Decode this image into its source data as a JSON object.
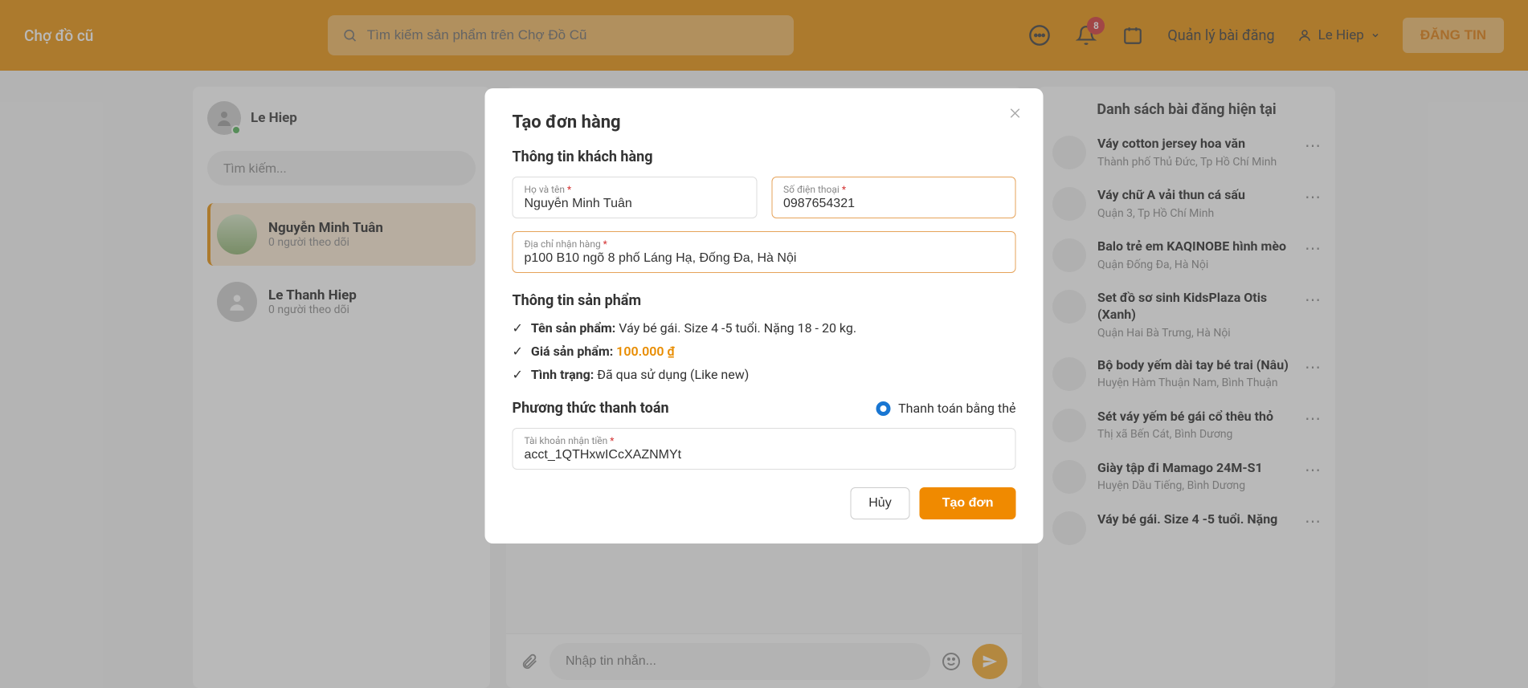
{
  "header": {
    "logo": "Chợ đồ cũ",
    "search_placeholder": "Tìm kiếm sản phẩm trên Chợ Đồ Cũ",
    "notif_badge": "8",
    "manage_label": "Quản lý bài đăng",
    "user_name": "Le Hiep",
    "post_button": "ĐĂNG TIN"
  },
  "left": {
    "me_name": "Le Hiep",
    "search_placeholder": "Tìm kiếm...",
    "conversations": [
      {
        "name": "Nguyễn Minh Tuân",
        "sub": "0 người theo dõi"
      },
      {
        "name": "Le Thanh Hiep",
        "sub": "0 người theo dõi"
      }
    ]
  },
  "chat": {
    "input_placeholder": "Nhập tin nhắn..."
  },
  "right": {
    "title": "Danh sách bài đăng hiện tại",
    "posts": [
      {
        "title": "Váy cotton jersey hoa văn",
        "loc": "Thành phố Thủ Đức, Tp Hồ Chí Minh"
      },
      {
        "title": "Váy chữ A vải thun cá sấu",
        "loc": "Quận 3, Tp Hồ Chí Minh"
      },
      {
        "title": "Balo trẻ em KAQINOBE hình mèo",
        "loc": "Quận Đống Đa, Hà Nội"
      },
      {
        "title": "Set đồ sơ sinh KidsPlaza Otis (Xanh)",
        "loc": "Quận Hai Bà Trưng, Hà Nội"
      },
      {
        "title": "Bộ body yếm dài tay bé trai (Nâu)",
        "loc": "Huyện Hàm Thuận Nam, Bình Thuận"
      },
      {
        "title": "Sét váy yếm bé gái cổ thêu thỏ",
        "loc": "Thị xã Bến Cát, Bình Dương"
      },
      {
        "title": "Giày tập đi Mamago 24M-S1",
        "loc": "Huyện Dầu Tiếng, Bình Dương"
      },
      {
        "title": "Váy bé gái. Size 4 -5 tuổi. Nặng",
        "loc": ""
      }
    ]
  },
  "modal": {
    "title": "Tạo đơn hàng",
    "section_customer": "Thông tin khách hàng",
    "field_name_label": "Họ và tên",
    "field_name_value": "Nguyễn Minh Tuân",
    "field_phone_label": "Số điện thoại",
    "field_phone_value": "0987654321",
    "field_address_label": "Địa chỉ nhận hàng",
    "field_address_value": "p100 B10 ngõ 8 phố Láng Hạ, Đống Đa, Hà Nội",
    "section_product": "Thông tin sản phẩm",
    "product_name_label": "Tên sản phẩm:",
    "product_name_value": "Váy bé gái. Size 4 -5 tuổi. Nặng 18 - 20 kg.",
    "product_price_label": "Giá sản phẩm:",
    "product_price_value": "100.000 ₫",
    "product_cond_label": "Tình trạng:",
    "product_cond_value": "Đã qua sử dụng (Like new)",
    "section_payment": "Phương thức thanh toán",
    "pay_option": "Thanh toán bằng thẻ",
    "field_account_label": "Tài khoản nhận tiền",
    "field_account_value": "acct_1QTHxwICcXAZNMYt",
    "btn_cancel": "Hủy",
    "btn_submit": "Tạo đơn"
  }
}
